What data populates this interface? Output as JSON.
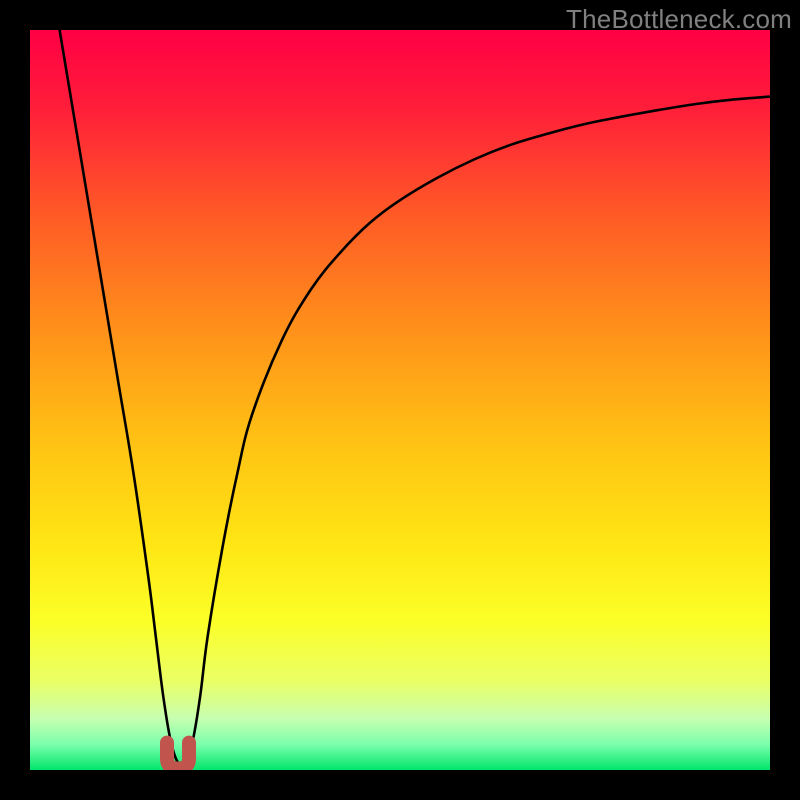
{
  "watermark": "TheBottleneck.com",
  "colors": {
    "frame": "#000000",
    "curve": "#000000",
    "marker": "#c1554d",
    "gradient_stops": [
      {
        "offset": 0.0,
        "color": "#ff0044"
      },
      {
        "offset": 0.1,
        "color": "#ff1c3a"
      },
      {
        "offset": 0.25,
        "color": "#ff5a26"
      },
      {
        "offset": 0.4,
        "color": "#ff8f1a"
      },
      {
        "offset": 0.55,
        "color": "#ffc014"
      },
      {
        "offset": 0.7,
        "color": "#ffe714"
      },
      {
        "offset": 0.8,
        "color": "#fbff28"
      },
      {
        "offset": 0.88,
        "color": "#eaff66"
      },
      {
        "offset": 0.93,
        "color": "#c7ffb0"
      },
      {
        "offset": 0.965,
        "color": "#7cffad"
      },
      {
        "offset": 1.0,
        "color": "#00e66a"
      }
    ]
  },
  "chart_data": {
    "type": "line",
    "title": "",
    "xlabel": "",
    "ylabel": "",
    "xlim": [
      0,
      100
    ],
    "ylim": [
      0,
      100
    ],
    "note": "V-shaped bottleneck curve; minimum near x≈20. Values are read off the rendered curve height as percent of plot height (0=bottom, 100=top).",
    "series": [
      {
        "name": "bottleneck-curve",
        "x": [
          4,
          6,
          8,
          10,
          12,
          14,
          16,
          17,
          18,
          19,
          20,
          21,
          22,
          23,
          24,
          26,
          28,
          30,
          34,
          38,
          42,
          46,
          50,
          55,
          60,
          65,
          70,
          75,
          80,
          85,
          90,
          95,
          100
        ],
        "values": [
          100,
          88,
          76,
          64,
          52,
          40,
          26,
          18,
          10,
          4,
          1,
          1,
          4,
          10,
          18,
          30,
          40,
          48,
          58,
          65,
          70,
          74,
          77,
          80,
          82.5,
          84.5,
          86,
          87.3,
          88.3,
          89.2,
          90,
          90.6,
          91
        ]
      }
    ],
    "marker": {
      "x": 20,
      "y": 1,
      "shape": "u",
      "color": "#c1554d"
    }
  }
}
